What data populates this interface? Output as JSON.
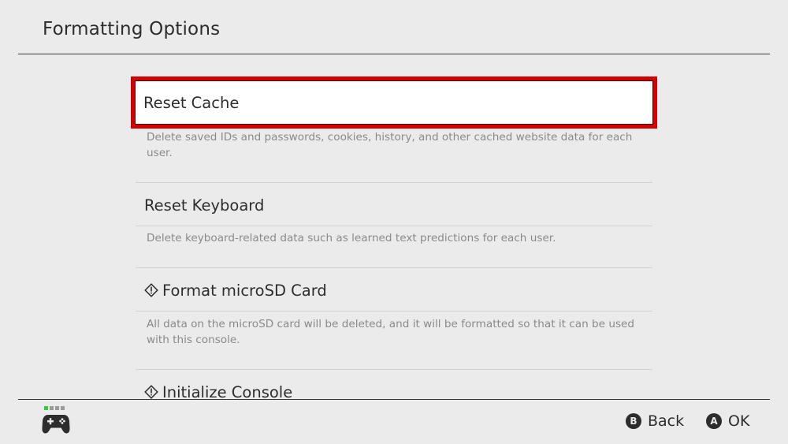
{
  "header": {
    "title": "Formatting Options"
  },
  "options": [
    {
      "label": "Reset Cache",
      "description": "Delete saved IDs and passwords, cookies, history, and other cached website data for each user.",
      "selected": true,
      "warning": false
    },
    {
      "label": "Reset Keyboard",
      "description": "Delete keyboard-related data such as learned text predictions for each user.",
      "selected": false,
      "warning": false
    },
    {
      "label": "Format microSD Card",
      "description": "All data on the microSD card will be deleted, and it will be formatted so that it can be used with this console.",
      "selected": false,
      "warning": true
    },
    {
      "label": "Initialize Console",
      "selected": false,
      "warning": true
    }
  ],
  "footer": {
    "controller_icon": "gamepad-icon",
    "player_indicator": [
      "#33cc33",
      "#9a9a9a",
      "#9a9a9a",
      "#9a9a9a"
    ],
    "back": {
      "glyph": "B",
      "label": "Back"
    },
    "ok": {
      "glyph": "A",
      "label": "OK"
    }
  },
  "colors": {
    "background": "#ebebeb",
    "selection": "#d40000",
    "text": "#2d2d2d",
    "description": "#8a8a8a"
  }
}
